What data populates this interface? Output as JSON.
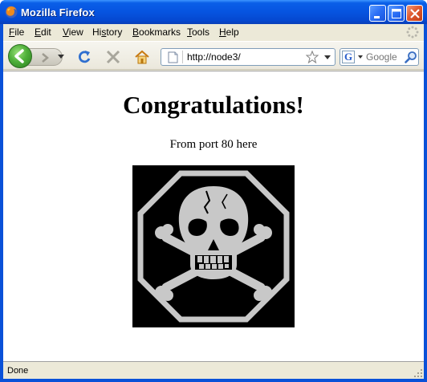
{
  "window": {
    "title": "Mozilla Firefox",
    "icon": "firefox-icon",
    "controls": [
      "minimize-icon",
      "maximize-icon",
      "close-icon"
    ]
  },
  "menu": {
    "items": [
      {
        "accel": "F",
        "rest": "ile"
      },
      {
        "accel": "E",
        "rest": "dit"
      },
      {
        "accel": "V",
        "rest": "iew"
      },
      {
        "accel": "",
        "pre": "Hi",
        "accel2": "s",
        "rest": "tory"
      },
      {
        "accel": "B",
        "rest": "ookmarks"
      },
      {
        "accel": "T",
        "rest": "ools"
      },
      {
        "accel": "H",
        "rest": "elp"
      }
    ]
  },
  "toolbar": {
    "url": "http://node3/",
    "search_placeholder": "Google",
    "icons": [
      "back-icon",
      "forward-icon",
      "reload-icon",
      "stop-icon",
      "home-icon",
      "page-icon",
      "bookmark-star-icon",
      "google-icon",
      "search-icon"
    ]
  },
  "page": {
    "heading": "Congratulations!",
    "subtext": "From port 80 here",
    "image": "skull-and-crossbones-icon"
  },
  "status": {
    "text": "Done"
  },
  "colors": {
    "titlebar": "#0654e0",
    "chrome": "#ece9d8",
    "close_button": "#e05a30",
    "back_button": "#4fb03a"
  }
}
